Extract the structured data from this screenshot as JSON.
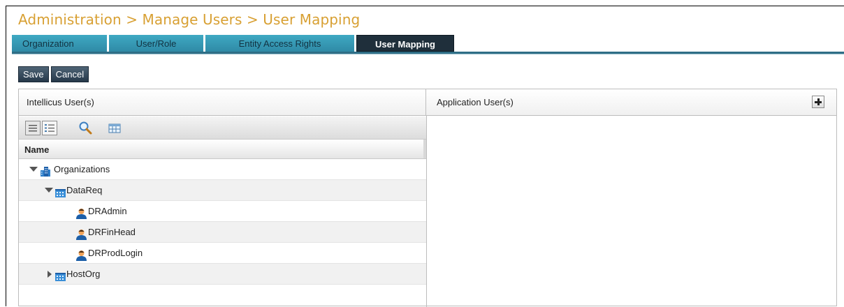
{
  "breadcrumb": "Administration > Manage Users > User Mapping",
  "tabs": [
    {
      "label": "Organization",
      "active": false
    },
    {
      "label": "User/Role",
      "active": false
    },
    {
      "label": "Entity Access Rights",
      "active": false
    },
    {
      "label": "User Mapping",
      "active": true
    }
  ],
  "actions": {
    "save_label": "Save",
    "cancel_label": "Cancel"
  },
  "left_panel": {
    "title": "Intellicus User(s)",
    "toolbar_icons": [
      "list-view-icon",
      "detail-view-icon",
      "search-icon",
      "grid-view-icon"
    ],
    "column_header": "Name",
    "tree": [
      {
        "label": "Organizations",
        "type": "organizations",
        "expanded": true
      },
      {
        "label": "DataReq",
        "type": "organization",
        "expanded": true
      },
      {
        "label": "DRAdmin",
        "type": "user"
      },
      {
        "label": "DRFinHead",
        "type": "user"
      },
      {
        "label": "DRProdLogin",
        "type": "user"
      },
      {
        "label": "HostOrg",
        "type": "organization",
        "expanded": false
      }
    ]
  },
  "right_panel": {
    "title": "Application User(s)",
    "add_icon": "plus-icon"
  },
  "colors": {
    "title": "#d8a033",
    "tab": "#3fa9c3",
    "active_tab": "#1f2f3b",
    "button": "#34495c"
  }
}
